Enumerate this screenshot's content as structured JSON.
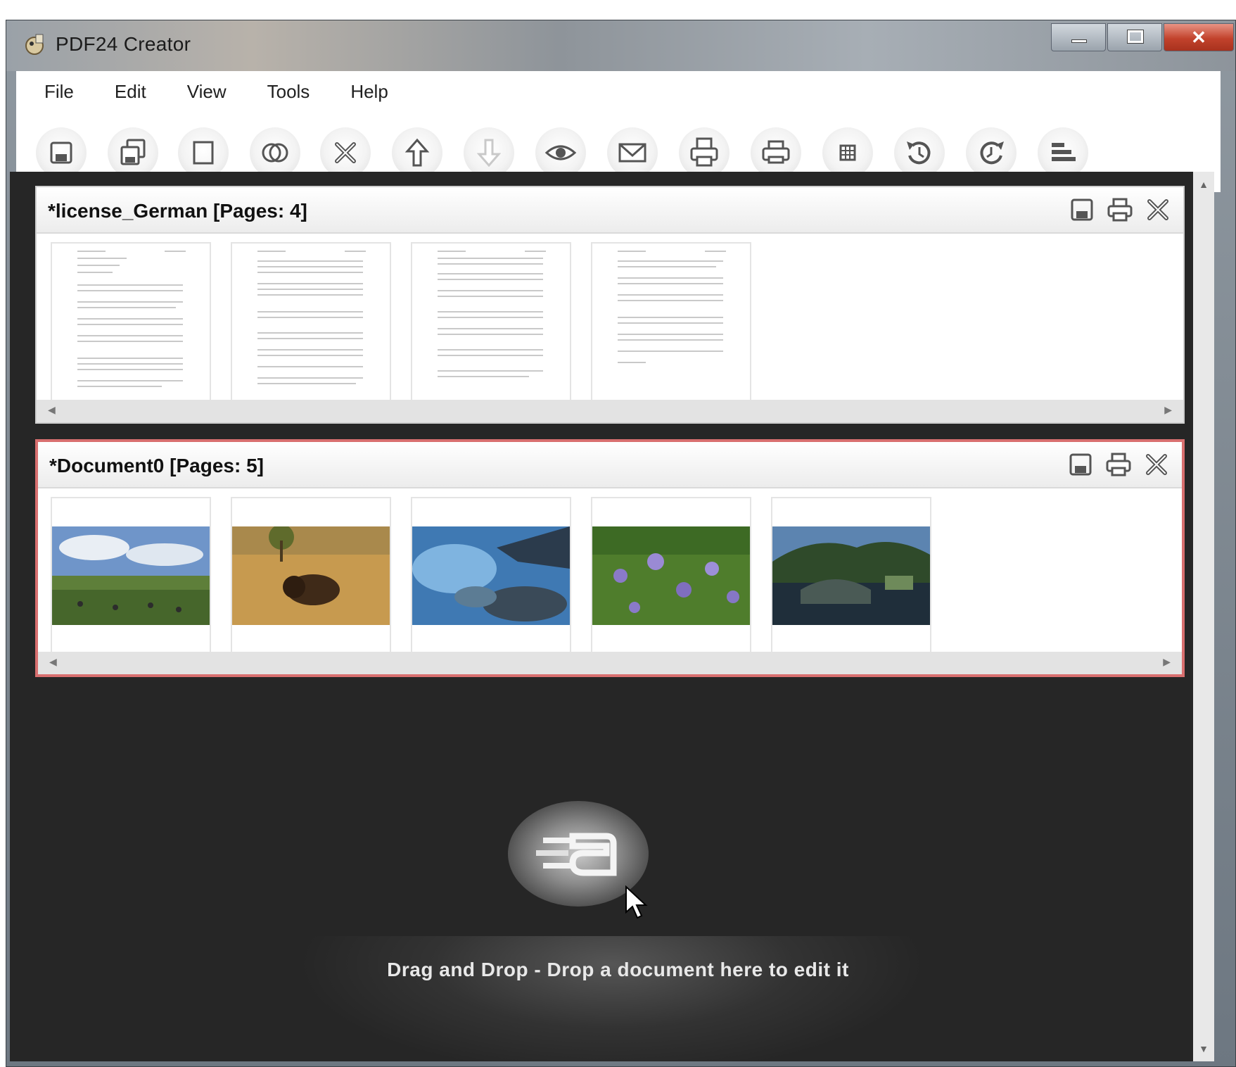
{
  "window": {
    "title": "PDF24 Creator"
  },
  "menu": [
    "File",
    "Edit",
    "View",
    "Tools",
    "Help"
  ],
  "toolbar": {
    "icons": [
      "save-icon",
      "save-copy-icon",
      "new-document-icon",
      "merge-icon",
      "delete-icon",
      "move-up-icon",
      "move-down-icon",
      "preview-icon",
      "email-icon",
      "print-icon",
      "print-settings-icon",
      "page-layout-icon",
      "rotate-left-icon",
      "rotate-right-icon",
      "align-icon"
    ]
  },
  "documents": [
    {
      "title": "*license_German [Pages: 4]",
      "type": "text"
    },
    {
      "title": "*Document0 [Pages: 5]",
      "type": "photos"
    }
  ],
  "dropzone": {
    "text": "Drag and Drop - Drop a document here to edit it"
  },
  "colors": {
    "selected_border": "#d86f6f",
    "workspace": "#262626"
  }
}
